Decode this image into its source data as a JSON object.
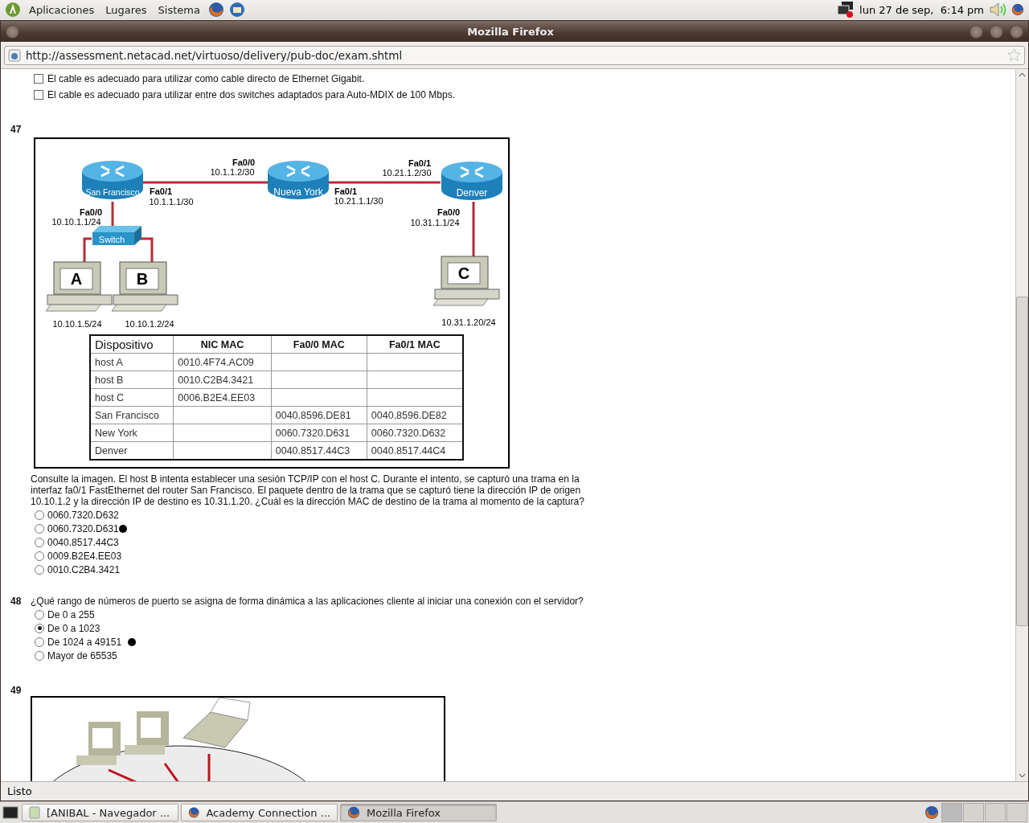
{
  "top_panel": {
    "menus": [
      "Aplicaciones",
      "Lugares",
      "Sistema"
    ],
    "clock": "lun 27 de sep,  6:14 pm"
  },
  "window": {
    "title": "Mozilla Firefox",
    "url": "http://assessment.netacad.net/virtuoso/delivery/pub-doc/exam.shtml"
  },
  "previous_options": [
    {
      "label": "El cable es adecuado para utilizar como cable directo de Ethernet Gigabit.",
      "checked": false
    },
    {
      "label": "El cable es adecuado para utilizar entre dos switches adaptados para Auto-MDIX de 100 Mbps.",
      "checked": false
    }
  ],
  "questions": [
    {
      "number": "47",
      "figure": {
        "kind": "network",
        "routers": [
          "San Francisco",
          "Nueva York",
          "Denver"
        ],
        "switch": "Switch",
        "interfaces": [
          {
            "port": "Fa0/0",
            "ip": "10.1.1.2/30"
          },
          {
            "port": "Fa0/1",
            "ip": "10.1.1.1/30"
          },
          {
            "port": "Fa0/0",
            "ip": "10.10.1.1/24"
          },
          {
            "port": "Fa0/1",
            "ip": "10.21.1.2/30"
          },
          {
            "port": "Fa0/1",
            "ip": "10.21.1.1/30"
          },
          {
            "port": "Fa0/0",
            "ip": "10.31.1.1/24"
          }
        ],
        "hosts": [
          {
            "letter": "A",
            "ip": "10.10.1.5/24"
          },
          {
            "letter": "B",
            "ip": "10.10.1.2/24"
          },
          {
            "letter": "C",
            "ip": "10.31.1.20/24"
          }
        ],
        "table": {
          "columns": [
            "Dispositivo",
            "NIC MAC",
            "Fa0/0 MAC",
            "Fa0/1 MAC"
          ],
          "rows": [
            [
              "host A",
              "0010.4F74.AC09",
              "",
              ""
            ],
            [
              "host B",
              "0010.C2B4.3421",
              "",
              ""
            ],
            [
              "host C",
              "0006.B2E4.EE03",
              "",
              ""
            ],
            [
              "San Francisco",
              "",
              "0040.8596.DE81",
              "0040.8596.DE82"
            ],
            [
              "New York",
              "",
              "0060.7320.D631",
              "0060.7320.D632"
            ],
            [
              "Denver",
              "",
              "0040.8517.44C3",
              "0040.8517.44C4"
            ]
          ]
        }
      },
      "text": "Consulte la imagen. El host B intenta establecer una sesión TCP/IP con el host C. Durante el intento, se capturó una trama en la interfaz fa0/1 FastEthernet del router San Francisco. El paquete dentro de la trama que se capturó tiene la dirección IP de origen 10.10.1.2 y la dirección IP de destino es 10.31.1.20. ¿Cuál es la dirección MAC de destino de la trama al momento de la captura?",
      "options": [
        {
          "label": "0060.7320.D632",
          "selected": false,
          "marked": false
        },
        {
          "label": "0060.7320.D631",
          "selected": false,
          "marked": true
        },
        {
          "label": "0040.8517.44C3",
          "selected": false,
          "marked": false
        },
        {
          "label": "0009.B2E4.EE03",
          "selected": false,
          "marked": false
        },
        {
          "label": "0010.C2B4.3421",
          "selected": false,
          "marked": false
        }
      ]
    },
    {
      "number": "48",
      "text": "¿Qué rango de números de puerto se asigna de forma dinámica a las aplicaciones cliente al iniciar una conexión con el servidor?",
      "options": [
        {
          "label": "De 0 a 255",
          "selected": false,
          "marked": false
        },
        {
          "label": "De 0 a 1023",
          "selected": true,
          "marked": false
        },
        {
          "label": "De 1024 a 49151",
          "selected": false,
          "marked": true
        },
        {
          "label": "Mayor de 65535",
          "selected": false,
          "marked": false
        }
      ]
    },
    {
      "number": "49",
      "figure": {
        "kind": "lan"
      }
    }
  ],
  "status_bar": "Listo",
  "taskbar": [
    {
      "label": "[ANIBAL - Navegador ...",
      "selected": false
    },
    {
      "label": "Academy Connection ...",
      "selected": false
    },
    {
      "label": "Mozilla Firefox",
      "selected": true
    }
  ]
}
